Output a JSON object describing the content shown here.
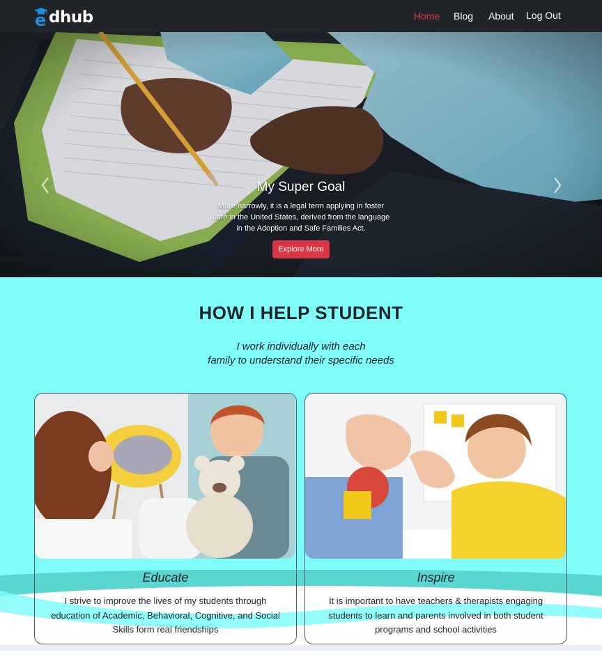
{
  "brand": {
    "prefix": "e",
    "rest": "dhub",
    "accent_color": "#1f8fe0"
  },
  "nav": {
    "home": "Home",
    "blog": "Blog",
    "about": "About",
    "logout": "Log Out",
    "active_color": "#dc3545"
  },
  "hero": {
    "title": "My Super Goal",
    "text": "More narrowly, it is a legal term applying in foster care in the United States, derived from the language in the Adoption and Safe Families Act.",
    "button_label": "Explore More",
    "prev_icon": "chevron-left-icon",
    "next_icon": "chevron-right-icon"
  },
  "section": {
    "title": "HOW I HELP STUDENT",
    "subtitle_line1": "I work individually with each",
    "subtitle_line2": "family to understand their specific needs",
    "background_color": "#7ffdfa"
  },
  "cards": [
    {
      "title": "Educate",
      "text": "I strive to improve the lives of my students through education of Academic, Behavioral, Cognitive, and Social Skills form real friendships"
    },
    {
      "title": "Inspire",
      "text": "It is important to have teachers & therapists engaging students to learn and parents involved in both student programs and school activities"
    }
  ]
}
